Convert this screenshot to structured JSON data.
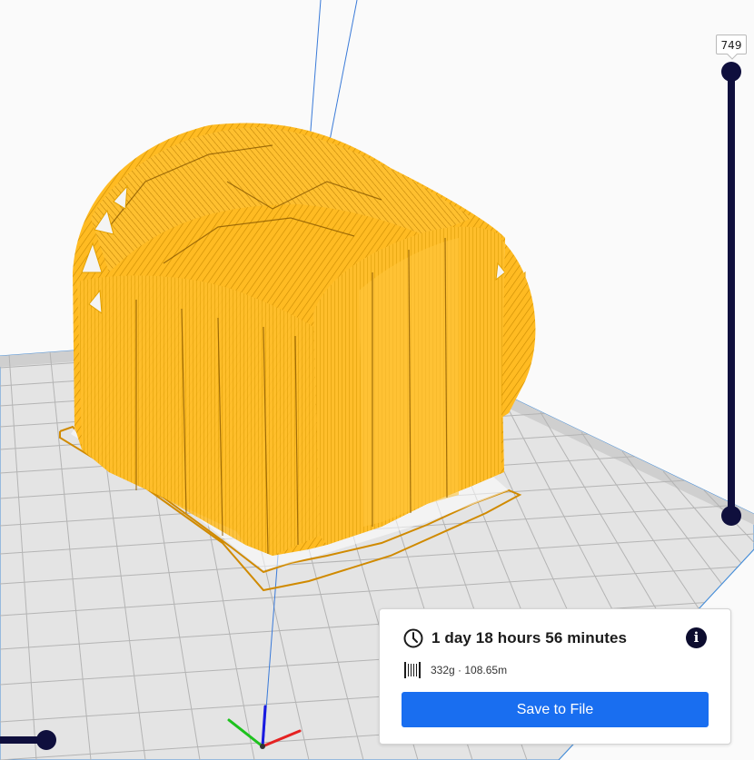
{
  "layer_slider": {
    "current_layer_label": "749"
  },
  "print_info": {
    "time": "1 day 18 hours 56 minutes",
    "material": "332g · 108.65m",
    "save_label": "Save to File",
    "info_glyph": "i"
  },
  "icons": {
    "time": "clock-icon",
    "material": "spool-icon",
    "info": "info-icon"
  },
  "colors": {
    "model": "#ffbe2b",
    "accent": "#196ef0",
    "slider": "#0f0f3d",
    "grid_bed": "#e6e6e6"
  }
}
